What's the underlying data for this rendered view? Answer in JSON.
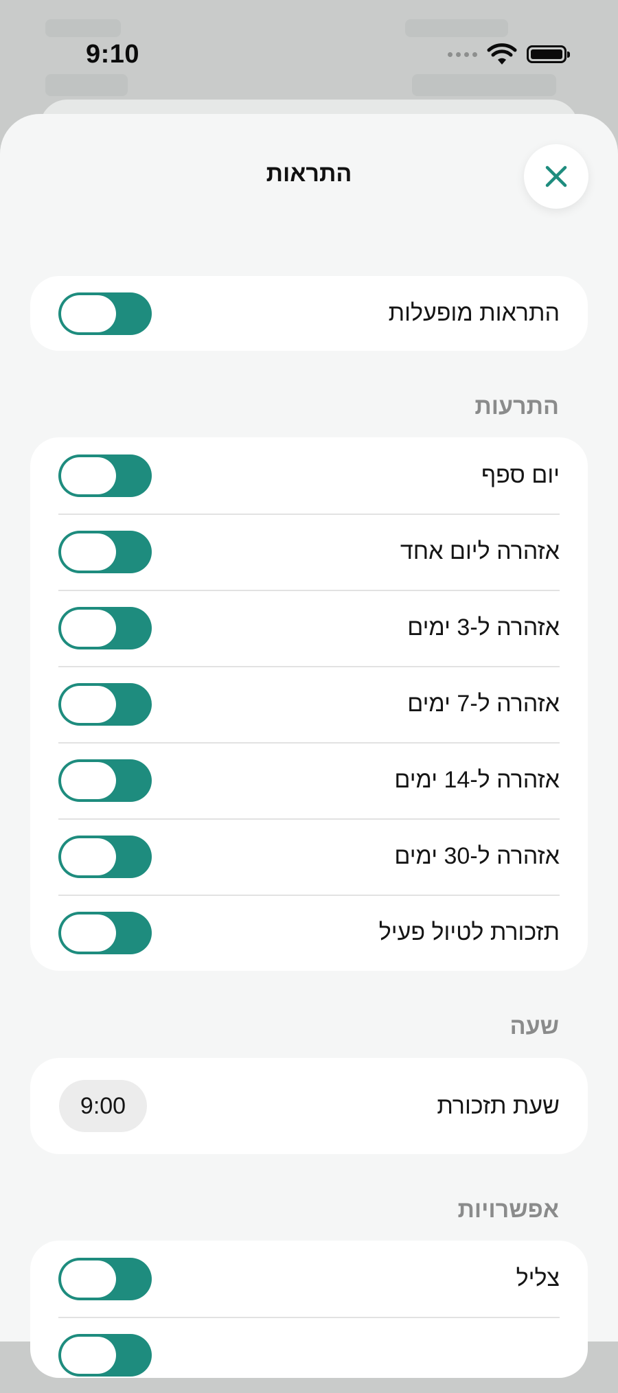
{
  "status_bar": {
    "time": "9:10",
    "icons": [
      "signal-dots-icon",
      "wifi-icon",
      "battery-icon"
    ]
  },
  "header": {
    "title": "התראות",
    "close_icon": "close-icon"
  },
  "master": {
    "label": "התראות מופעלות",
    "enabled": true
  },
  "sections": {
    "alerts": {
      "title": "התרעות",
      "items": [
        {
          "label": "יום ספף",
          "enabled": true
        },
        {
          "label": "אזהרה ליום אחד",
          "enabled": true
        },
        {
          "label": "אזהרה ל-3 ימים",
          "enabled": true
        },
        {
          "label": "אזהרה ל-7 ימים",
          "enabled": true
        },
        {
          "label": "אזהרה ל-14 ימים",
          "enabled": true
        },
        {
          "label": "אזהרה ל-30 ימים",
          "enabled": true
        },
        {
          "label": "תזכורת לטיול פעיל",
          "enabled": true
        }
      ]
    },
    "time": {
      "title": "שעה",
      "reminder_label": "שעת תזכורת",
      "reminder_value": "9:00"
    },
    "options": {
      "title": "אפשרויות",
      "items": [
        {
          "label": "צליל",
          "enabled": true
        }
      ]
    }
  },
  "colors": {
    "accent": "#1e8c7e",
    "sheet_background": "#f5f6f6",
    "card_background": "#ffffff",
    "section_header": "#8a8b8b"
  }
}
